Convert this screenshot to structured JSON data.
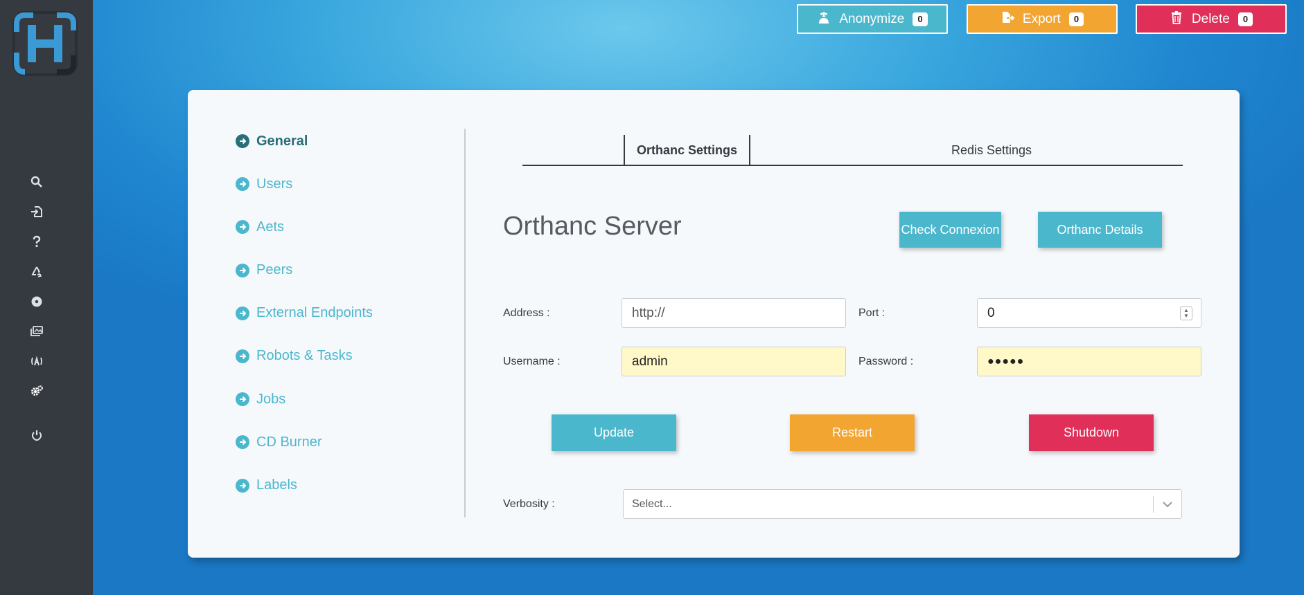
{
  "colors": {
    "sidebar": "#343a40",
    "teal": "#4bb7cd",
    "orange": "#f2a531",
    "red": "#e0305a",
    "active_menu": "#2a6f78"
  },
  "sidebar": {
    "logo": "H",
    "icons": [
      "search-icon",
      "file-import-icon",
      "question-icon",
      "recycle-icon",
      "disc-icon",
      "images-icon",
      "broadcast-icon",
      "gears-icon",
      "power-icon"
    ]
  },
  "topbar": {
    "anonymize": {
      "label": "Anonymize",
      "count": "0",
      "icon": "user-secret-icon"
    },
    "export": {
      "label": "Export",
      "count": "0",
      "icon": "file-export-icon"
    },
    "delete": {
      "label": "Delete",
      "count": "0",
      "icon": "trash-icon"
    }
  },
  "menu": {
    "items": [
      {
        "label": "General",
        "active": true
      },
      {
        "label": "Users"
      },
      {
        "label": "Aets"
      },
      {
        "label": "Peers"
      },
      {
        "label": "External Endpoints"
      },
      {
        "label": "Robots & Tasks"
      },
      {
        "label": "Jobs"
      },
      {
        "label": "CD Burner"
      },
      {
        "label": "Labels"
      }
    ]
  },
  "tabs": {
    "orthanc": "Orthanc Settings",
    "redis": "Redis Settings",
    "active": "Orthanc Settings"
  },
  "server": {
    "title": "Orthanc Server",
    "check_button": "Check Connexion",
    "details_button": "Orthanc Details"
  },
  "form": {
    "address_label": "Address :",
    "address_value": "http://",
    "port_label": "Port :",
    "port_value": "0",
    "username_label": "Username :",
    "username_value": "admin",
    "password_label": "Password :",
    "password_value": "●●●●●",
    "verbosity_label": "Verbosity :",
    "verbosity_placeholder": "Select..."
  },
  "actions": {
    "update": "Update",
    "restart": "Restart",
    "shutdown": "Shutdown"
  }
}
